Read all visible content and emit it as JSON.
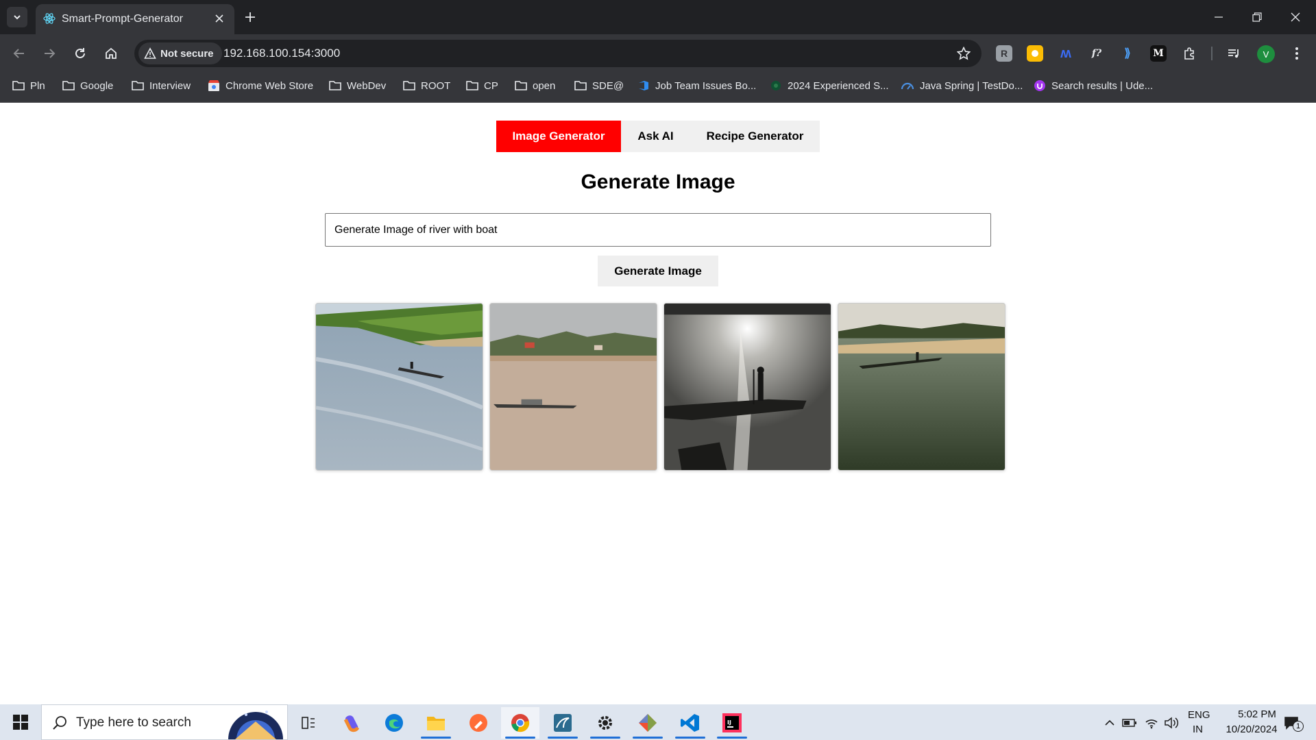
{
  "browser": {
    "tab_title": "Smart-Prompt-Generator",
    "security_label": "Not secure",
    "url": "192.168.100.154:3000",
    "profile_initial": "V",
    "accent": "#202124"
  },
  "bookmarks": [
    {
      "label": "Pln",
      "icon": "folder-icon"
    },
    {
      "label": "Google",
      "icon": "folder-icon"
    },
    {
      "label": "Interview",
      "icon": "folder-icon"
    },
    {
      "label": "Chrome Web Store",
      "icon": "chrome-web-store-icon"
    },
    {
      "label": "WebDev",
      "icon": "folder-icon"
    },
    {
      "label": "ROOT",
      "icon": "folder-icon"
    },
    {
      "label": "CP",
      "icon": "folder-icon"
    },
    {
      "label": "open",
      "icon": "folder-icon"
    },
    {
      "label": "SDE@",
      "icon": "folder-icon"
    },
    {
      "label": "Job Team Issues Bo...",
      "icon": "azure-devops-icon"
    },
    {
      "label": "2024 Experienced S...",
      "icon": "site-icon"
    },
    {
      "label": "Java Spring | TestDo...",
      "icon": "testdome-icon"
    },
    {
      "label": "Search results | Ude...",
      "icon": "udemy-icon"
    }
  ],
  "app": {
    "tabs": [
      {
        "label": "Image Generator",
        "active": true
      },
      {
        "label": "Ask AI",
        "active": false
      },
      {
        "label": "Recipe Generator",
        "active": false
      }
    ],
    "title": "Generate Image",
    "prompt_value": "Generate Image of river with boat",
    "button_label": "Generate Image",
    "active_color": "#ff0000",
    "images": [
      {
        "alt": "river with boat 1"
      },
      {
        "alt": "river with boat 2"
      },
      {
        "alt": "river with boat 3"
      },
      {
        "alt": "river with boat 4"
      }
    ]
  },
  "taskbar": {
    "search_placeholder": "Type here to search",
    "language": "ENG",
    "region": "IN",
    "time": "5:02 PM",
    "date": "10/20/2024",
    "notification_count": "1"
  }
}
